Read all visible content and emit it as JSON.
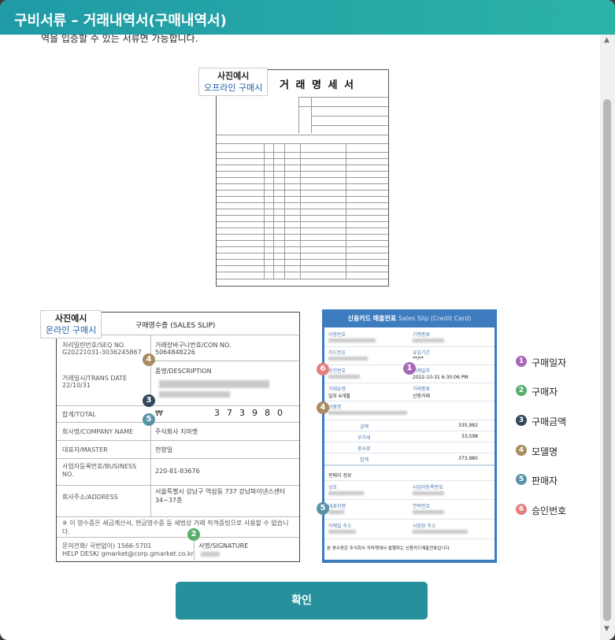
{
  "header": {
    "title": "구비서류 – 거래내역서(구매내역서)"
  },
  "intro": "역을 입증할 수 있는 서류면 가능합니다.",
  "offline": {
    "badge_l1": "사진예시",
    "badge_l2": "오프라인 구매시",
    "title": "거 래 명 세 서"
  },
  "online": {
    "badge_l1": "사진예시",
    "badge_l2": "온라인 구매시",
    "slip_title": "구매영수증 (SALES SLIP)",
    "seq_label": "처리일련번호/SEQ NO.",
    "seq_value": "G20221031-3036245867",
    "con_label": "거래장바구니번호/CON NO.",
    "con_value": "5064848226",
    "date_label": "거래일시/TRANS DATE",
    "date_value": "22/10/31",
    "desc_label": "품명/DESCRIPTION",
    "total_label": "합계/TOTAL",
    "total_currency": "₩",
    "total_digits": [
      "3",
      "7",
      "3",
      "9",
      "8",
      "0"
    ],
    "company_label": "회사명/COMPANY NAME",
    "company_value": "주식회사 지마켓",
    "master_label": "대표자/MASTER",
    "master_value": "전항일",
    "bizno_label": "사업자등록번호/BUSINESS NO.",
    "bizno_value": "220-81-83676",
    "address_label": "회사주소/ADDRESS",
    "address_value": "서울특별시 강남구 역삼동 737 강남파이낸스센터 34~37층",
    "note": "※ 이 영수증은 세금계산서, 현금영수증 등 세법상 거래 적격증빙으로 사용할 수 없습니다.",
    "helpdesk_l1": "문의전화/ 국번없이) 1566-5701",
    "helpdesk_l2": "HELP DESK/ gmarket@corp.gmarket.co.kr",
    "sign_label": "서명/SIGNATURE"
  },
  "card": {
    "title": "신용카드 매출전표",
    "subtitle": "Sales Slip (Credit Card)",
    "f1a": "이용번호",
    "f1b": "가맹종류",
    "f2a": "카드번호",
    "f2b": "유효기간",
    "f2b_val": "**/**",
    "f3a": "승인번호",
    "f3b": "거래일자",
    "f3b_val": "2022-10-31 6:30:06 PM",
    "f4a": "거래유형",
    "f4a_val": "일부 6개월",
    "f4b": "거래종류",
    "f4b_val": "신용거래",
    "f5": "상품명",
    "amt_label": "금액",
    "amt_val": "335,982",
    "vat_label": "부가세",
    "vat_val": "33,598",
    "tip_label": "봉사료",
    "tip_val": "",
    "sum_label": "합계",
    "sum_val": "373,980",
    "seller_title": "판매자 정보",
    "s1a": "상호",
    "s1b": "사업자등록번호",
    "s2a": "대표자명",
    "s2b": "연락번호",
    "s3a": "이메일 주소",
    "s3b": "사업장 주소",
    "footer": "본 영수증은 주식회사 지마켓에서 발행하는 신용카드매출전표입니다."
  },
  "legend": [
    {
      "n": "1",
      "label": "구매일자"
    },
    {
      "n": "2",
      "label": "구매자"
    },
    {
      "n": "3",
      "label": "구매금액"
    },
    {
      "n": "4",
      "label": "모델명"
    },
    {
      "n": "5",
      "label": "판매자"
    },
    {
      "n": "6",
      "label": "승인번호"
    }
  ],
  "markers": {
    "m1": "1",
    "m2": "2",
    "m3": "3",
    "m4": "4",
    "m5": "5",
    "m6": "6"
  },
  "confirm_button": "확인"
}
